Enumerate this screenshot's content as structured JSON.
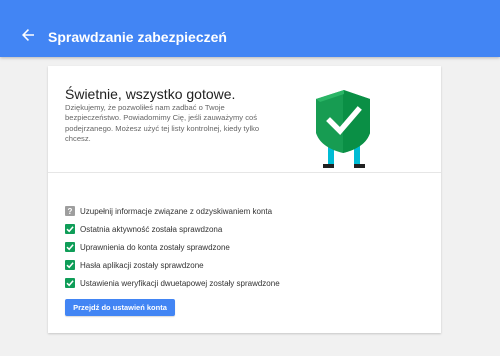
{
  "header": {
    "title": "Sprawdzanie zabezpieczeń",
    "back_icon": "arrow-back-icon",
    "color": "#4285f4"
  },
  "card": {
    "headline": "Świetnie, wszystko gotowe.",
    "description": "Dziękujemy, że pozwoliłeś nam zadbać o Twoje bezpieczeństwo. Powiadomimy Cię, jeśli zauważymy coś podejrzanego. Możesz użyć tej listy kontrolnej, kiedy tylko chcesz.",
    "illustration": "shield-check-icon"
  },
  "checklist": [
    {
      "label": "Uzupełnij informacje związane z odzyskiwaniem konta",
      "status": "unknown",
      "color": "#9e9e9e"
    },
    {
      "label": "Ostatnia aktywność została sprawdzona",
      "status": "done",
      "color": "#0f9d58"
    },
    {
      "label": "Uprawnienia do konta zostały sprawdzone",
      "status": "done",
      "color": "#0f9d58"
    },
    {
      "label": "Hasła aplikacji zostały sprawdzone",
      "status": "done",
      "color": "#0f9d58"
    },
    {
      "label": "Ustawienia weryfikacji dwuetapowej zostały sprawdzone",
      "status": "done",
      "color": "#0f9d58"
    }
  ],
  "actions": {
    "continue_label": "Przejdź do ustawień konta"
  }
}
